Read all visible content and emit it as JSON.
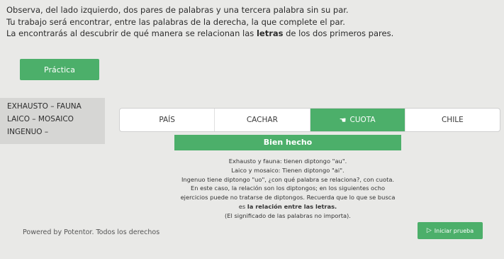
{
  "intro": {
    "line1": "Observa, del lado izquierdo, dos pares de palabras y una tercera palabra sin su par.",
    "line2": "Tu trabajo será encontrar, entre las palabras de la derecha, la que complete el par.",
    "line3_before": "La encontrarás al descubrir de qué manera se relacionan las ",
    "line3_bold": "letras",
    "line3_after": " de los dos primeros pares."
  },
  "practice_button": "Práctica",
  "pairs": [
    "EXHAUSTO – FAUNA",
    "LAICO – MOSAICO",
    "INGENUO –"
  ],
  "options": [
    {
      "label": "PAÍS",
      "selected": false
    },
    {
      "label": "CACHAR",
      "selected": false
    },
    {
      "label": "CUOTA",
      "selected": true
    },
    {
      "label": "CHILE",
      "selected": false
    }
  ],
  "feedback": {
    "title": "Bien hecho",
    "line1": "Exhausto y fauna: tienen diptongo \"au\".",
    "line2": "Laico y mosaico: Tienen diptongo \"ai\".",
    "line3": "Ingenuo tiene diptongo \"uo\", ¿con qué palabra se relaciona?, con cuota.",
    "line4": "En este caso, la relación son los diptongos; en los siguientes ocho ejercicios puede no tratarse de diptongos. Recuerda que lo que se busca es ",
    "line4_bold": "la relación entre las letras.",
    "line5": "(El significado de las palabras no importa)."
  },
  "footer": "Powered by Potentor. Todos los derechos",
  "start_button": "Iniciar prueba",
  "colors": {
    "accent": "#4caf6a",
    "background": "#e9e9e7"
  }
}
